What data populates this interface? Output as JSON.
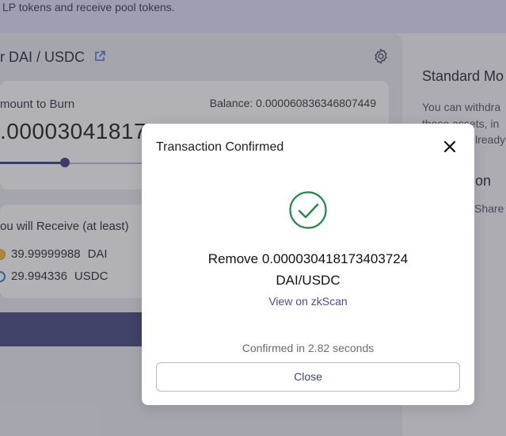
{
  "banner": {
    "text": "LP tokens and receive pool tokens."
  },
  "pair": {
    "title": "r DAI / USDC"
  },
  "amount": {
    "label": "mount to Burn",
    "balance": "Balance: 0.000060836346807449",
    "value": ".00003041817",
    "slider_fraction": 0.5
  },
  "receive": {
    "label": "ou will Receive (at least)",
    "tokens": [
      {
        "amount": "39.99999988",
        "symbol": "DAI"
      },
      {
        "amount": "29.994336",
        "symbol": "USDC"
      }
    ]
  },
  "side": {
    "title": "Standard Mo",
    "line1": "You can withdra",
    "line2": "these assets, in",
    "line3": "lready",
    "subtitle": "ction",
    "share": "Share"
  },
  "modal": {
    "title": "Transaction Confirmed",
    "message_line1": "Remove 0.000030418173403724",
    "message_line2": "DAI/USDC",
    "link_label": "View on zkScan",
    "confirmed_text": "Confirmed in 2.82 seconds",
    "close_label": "Close"
  },
  "colors": {
    "accent": "#3c3f78",
    "success": "#1f8a4c",
    "link": "#4a5190"
  },
  "icons": {
    "external": "external-link-icon",
    "settings": "gear-icon",
    "close": "close-icon",
    "success": "check-circle-icon"
  }
}
